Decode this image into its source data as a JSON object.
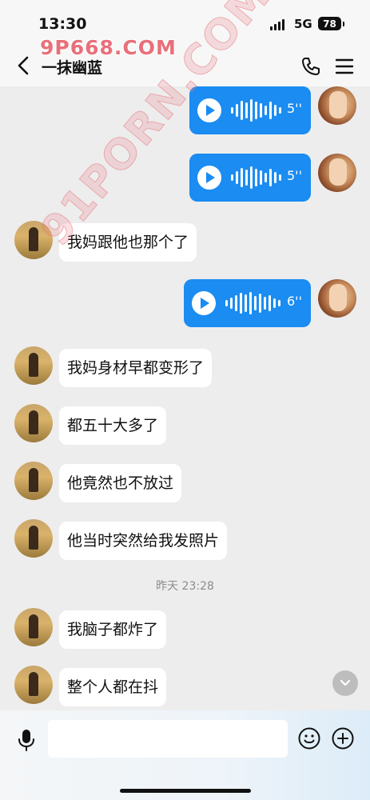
{
  "status": {
    "time": "13:30",
    "network": "5G",
    "battery": "78"
  },
  "watermark": {
    "top": "9P668.COM",
    "diagonal": "91PORN.COM"
  },
  "header": {
    "title": "一抹幽蓝"
  },
  "messages": [
    {
      "type": "voice",
      "side": "right",
      "duration": "5''"
    },
    {
      "type": "voice",
      "side": "right",
      "duration": "5''"
    },
    {
      "type": "text",
      "side": "left",
      "text": "我妈跟他也那个了"
    },
    {
      "type": "voice",
      "side": "right",
      "duration": "6''"
    },
    {
      "type": "text",
      "side": "left",
      "text": "我妈身材早都变形了"
    },
    {
      "type": "text",
      "side": "left",
      "text": "都五十大多了"
    },
    {
      "type": "text",
      "side": "left",
      "text": "他竟然也不放过"
    },
    {
      "type": "text",
      "side": "left",
      "text": "他当时突然给我发照片"
    },
    {
      "type": "text",
      "side": "left",
      "text": "我脑子都炸了"
    },
    {
      "type": "text",
      "side": "left",
      "text": "整个人都在抖"
    }
  ],
  "time_divider": "昨天 23:28",
  "icons": {
    "back": "chevron-left-icon",
    "phone": "phone-icon",
    "menu": "menu-icon",
    "mic": "microphone-icon",
    "emoji": "emoji-icon",
    "plus": "plus-icon",
    "scroll": "chevron-down-icon"
  },
  "colors": {
    "voice_bubble": "#1a8cf2",
    "background": "#ededed",
    "watermark": "#e8707a"
  }
}
